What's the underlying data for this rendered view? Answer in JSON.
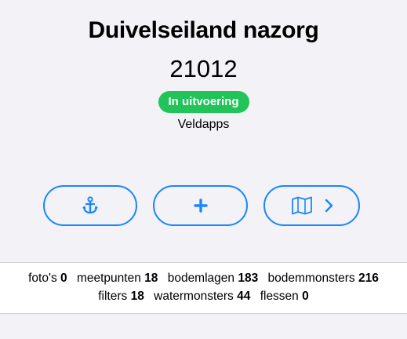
{
  "project": {
    "title": "Duivelseiland nazorg",
    "code": "21012",
    "status": "In uitvoering",
    "owner": "Veldapps"
  },
  "actions": [
    {
      "icon": "anchor-icon"
    },
    {
      "icon": "plus-icon"
    },
    {
      "icon": "map-icon",
      "extra_icon": "chevron-right-icon"
    }
  ],
  "stats": {
    "row1": [
      {
        "label": "foto's",
        "value": "0"
      },
      {
        "label": "meetpunten",
        "value": "18"
      },
      {
        "label": "bodemlagen",
        "value": "183"
      },
      {
        "label": "bodemmonsters",
        "value": "216"
      }
    ],
    "row2": [
      {
        "label": "filters",
        "value": "18"
      },
      {
        "label": "watermonsters",
        "value": "44"
      },
      {
        "label": "flessen",
        "value": "0"
      }
    ]
  },
  "colors": {
    "accent": "#1a85ff",
    "status": "#22c45a",
    "background": "#f2f2f7"
  }
}
